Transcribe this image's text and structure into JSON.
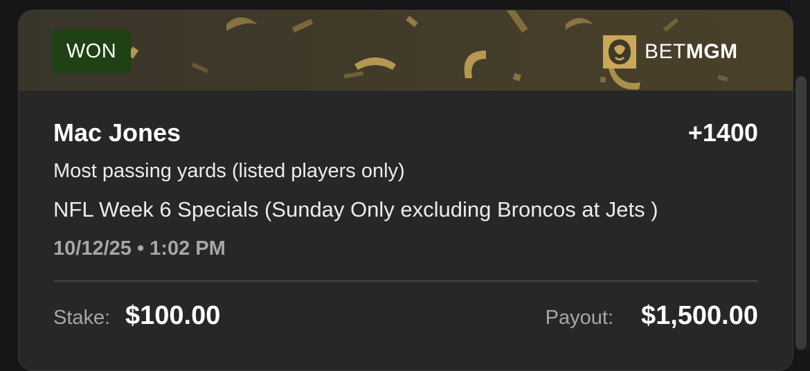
{
  "status_badge": "WON",
  "brand": {
    "bet": "BET",
    "mgm": "MGM",
    "logo_icon": "lion-head-icon"
  },
  "bet": {
    "player": "Mac Jones",
    "odds": "+1400",
    "market": "Most passing yards (listed players only)",
    "event": "NFL Week 6 Specials (Sunday Only excluding Broncos at Jets )",
    "datetime": "10/12/25 • 1:02 PM"
  },
  "footer": {
    "stake_label": "Stake:",
    "stake_value": "$100.00",
    "payout_label": "Payout:",
    "payout_value": "$1,500.00"
  },
  "colors": {
    "badge_bg": "#1f4114",
    "card_bg": "#272727",
    "banner_bg": "#3f3929",
    "confetti_gold": "#c9a85a"
  }
}
